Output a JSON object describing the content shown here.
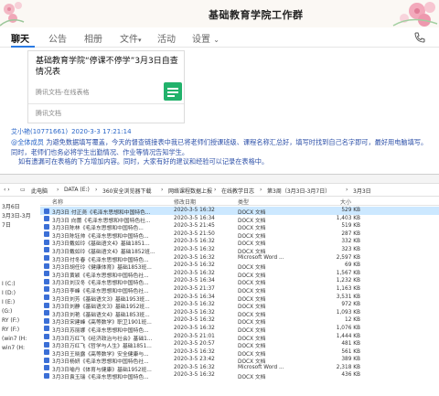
{
  "header": {
    "title": "基础教育学院工作群",
    "decoration": "flower-icon"
  },
  "tabs": [
    {
      "label": "聊天",
      "active": true
    },
    {
      "label": "公告"
    },
    {
      "label": "相册"
    },
    {
      "label": "文件",
      "suffix": "▾"
    },
    {
      "label": "活动"
    },
    {
      "label": "设置",
      "suffix": "⌄"
    }
  ],
  "card": {
    "title": "基础教育学院“停课不停学”3月3日自查情况表",
    "subtitle": "腾讯文档-在线表格",
    "footer": "腾讯文档",
    "icon": "sheet-icon",
    "icon_color": "#21b26b"
  },
  "message": {
    "sender": "艾小艳(10771661)",
    "time": "2020-3-3 17:21:14",
    "mention": "@全体成员",
    "text": "为避免数据填写覆盖，今天的督查链接表中我已将老师们授课班级、课程名称汇总好，填写时找到自己名字即可，最好用电脑填写。同时，老师们也务必将学生出勤情况、作业等情况告知学生。",
    "text2": "如有遗漏可在表格的下方增加内容。同时，大家有好的建议和经验可以记录在表格中。"
  },
  "explorer": {
    "breadcrumbs": [
      "此电脑",
      "DATA (E:)",
      "360安全浏览器下载",
      "网络课程数据上报",
      "在线教学日志",
      "第3周（3月3日-3月7日）",
      "3月3日"
    ],
    "sidebar": [
      "3月6日",
      "3月3日-3月",
      "7日",
      "I (C:)",
      "I (D:)",
      "I (E:)",
      "(G:)",
      "RY (F:)",
      "RY (F:)",
      "(win7 (H:",
      "win7 (H:"
    ],
    "columns": {
      "name": "名称",
      "date": "修改日期",
      "type": "类型",
      "size": "大小"
    },
    "files": [
      {
        "name": "3月3日 付正尧《毛泽东思想和中国特色...",
        "date": "2020-3-5 16:32",
        "type": "DOCX 文档",
        "size": "529 KB",
        "selected": true
      },
      {
        "name": "3月3日 向蕾《毛泽东思想和中国特色社...",
        "date": "2020-3-5 16:34",
        "type": "DOCX 文档",
        "size": "1,403 KB"
      },
      {
        "name": "3月3日陈林《毛泽东思想和中国特色...",
        "date": "2020-3-5 21:45",
        "type": "DOCX 文档",
        "size": "519 KB"
      },
      {
        "name": "3月3日陈钰帅《毛泽东思想和中国特色...",
        "date": "2020-3-5 21:50",
        "type": "DOCX 文档",
        "size": "287 KB"
      },
      {
        "name": "3月3日戴如玲《基础语文4》基础1851...",
        "date": "2020-3-5 16:32",
        "type": "DOCX 文档",
        "size": "332 KB"
      },
      {
        "name": "3月3日戴如玲《基础语文4》基础1852班...",
        "date": "2020-3-5 16:32",
        "type": "DOCX 文档",
        "size": "323 KB"
      },
      {
        "name": "3月3日付冬春《毛泽东思想和中国特色...",
        "date": "2020-3-5 16:32",
        "type": "Microsoft Word ...",
        "size": "2,597 KB"
      },
      {
        "name": "3月3日胡任玲《健康体育》基础1853班...",
        "date": "2020-3-5 16:32",
        "type": "DOCX 文档",
        "size": "69 KB"
      },
      {
        "name": "3月3日黄颖《毛泽东思想和中国特色社...",
        "date": "2020-3-5 16:32",
        "type": "DOCX 文档",
        "size": "1,567 KB"
      },
      {
        "name": "3月3日刘汉冬《毛泽东思想和中国特色...",
        "date": "2020-3-5 16:34",
        "type": "DOCX 文档",
        "size": "1,232 KB"
      },
      {
        "name": "3月3日李峰《毛泽东思想和中国特色社...",
        "date": "2020-3-5 21:37",
        "type": "DOCX 文档",
        "size": "1,163 KB"
      },
      {
        "name": "3月3日刘芳《基础语文3》基础1953班...",
        "date": "2020-3-5 16:34",
        "type": "DOCX 文档",
        "size": "3,531 KB"
      },
      {
        "name": "3月3日刘静《基础语文3》基础1952班...",
        "date": "2020-3-5 16:32",
        "type": "DOCX 文档",
        "size": "972 KB"
      },
      {
        "name": "3月3日刘艳《基础语文4》基础1853班...",
        "date": "2020-3-5 16:32",
        "type": "DOCX 文档",
        "size": "1,093 KB"
      },
      {
        "name": "3月3日宋建峰《高等数学》职卫1901班...",
        "date": "2020-3-5 16:32",
        "type": "DOCX 文档",
        "size": "12 KB"
      },
      {
        "name": "3月3日苏丽娜《毛泽东思想和中国特色...",
        "date": "2020-3-5 16:32",
        "type": "DOCX 文档",
        "size": "1,076 KB"
      },
      {
        "name": "3月3日万红飞《经济政治与社会》基础1...",
        "date": "2020-3-5 21:01",
        "type": "DOCX 文档",
        "size": "1,444 KB"
      },
      {
        "name": "3月3日万红飞《哲学与人生》基础1851...",
        "date": "2020-3-5 20:57",
        "type": "DOCX 文档",
        "size": "481 KB"
      },
      {
        "name": "3月3日王晓露《高等数学》安全健康与...",
        "date": "2020-3-5 16:32",
        "type": "DOCX 文档",
        "size": "561 KB"
      },
      {
        "name": "3月3日杨妍《毛泽东思想和中国特色社...",
        "date": "2020-3-5 23:42",
        "type": "DOCX 文档",
        "size": "389 KB"
      },
      {
        "name": "3月3日喻丹《体育与健康》基础1952班...",
        "date": "2020-3-5 16:32",
        "type": "Microsoft Word ...",
        "size": "2,318 KB"
      },
      {
        "name": "3月3日袁玉瑞《毛泽东思想和中国特色...",
        "date": "2020-3-5 16:32",
        "type": "DOCX 文档",
        "size": "436 KB"
      }
    ]
  }
}
